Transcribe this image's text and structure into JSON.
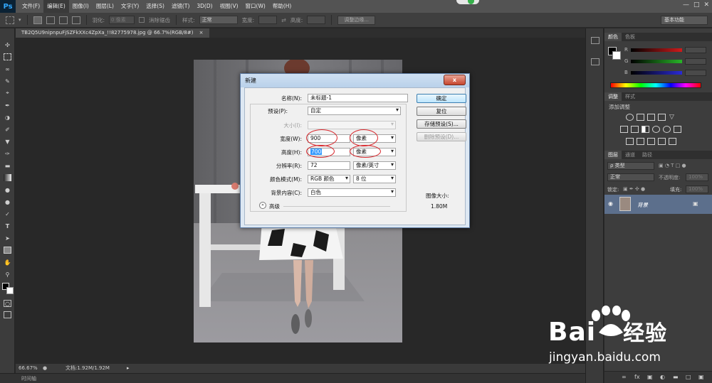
{
  "menubar": {
    "logo": "Ps",
    "items": [
      "文件(F)",
      "编辑(E)",
      "图像(I)",
      "图层(L)",
      "文字(Y)",
      "选择(S)",
      "滤镜(T)",
      "3D(D)",
      "视图(V)",
      "窗口(W)",
      "帮助(H)"
    ],
    "active_index": 1
  },
  "options_bar": {
    "feather_label": "羽化:",
    "feather_value": "0 像素",
    "antialias_label": "消除锯齿",
    "style_label": "样式:",
    "style_value": "正常",
    "width_label": "宽度:",
    "height_label": "高度:",
    "refine_edge_label": "调整边缘...",
    "workspace": "基本功能"
  },
  "document": {
    "tab_title": "TB2Q5U9nipnpuFjSZFkXXc4ZpXa_!!82775978.jpg @ 66.7%(RGB/8#)",
    "tab_close": "×",
    "zoom": "66.67%",
    "doc_info": "文档:1.92M/1.92M",
    "timeline_label": "时间轴"
  },
  "color_panel": {
    "tabs": [
      "颜色",
      "色板"
    ],
    "channels": [
      "R",
      "G",
      "B"
    ],
    "channel_colors": [
      "#d01b1b",
      "#28b428",
      "#2a2ad6"
    ]
  },
  "adjustments_panel": {
    "tabs": [
      "调整",
      "样式"
    ],
    "heading": "添加调整"
  },
  "layers_panel": {
    "tabs": [
      "图层",
      "通道",
      "路径"
    ],
    "filter_label": "ρ 类型",
    "blend_mode": "正常",
    "opacity_label": "不透明度:",
    "opacity_value": "100%",
    "lock_label": "锁定:",
    "fill_label": "填充:",
    "fill_value": "100%",
    "layer_name": "背景"
  },
  "new_dialog": {
    "title": "新建",
    "close": "x",
    "name_label": "名称(N):",
    "name_value": "未标题-1",
    "preset_label": "预设(P):",
    "preset_value": "自定",
    "size_label": "大小(I):",
    "width_label": "宽度(W):",
    "width_value": "900",
    "width_unit": "像素",
    "height_label": "高度(H):",
    "height_value": "700",
    "height_unit": "像素",
    "resolution_label": "分辨率(R):",
    "resolution_value": "72",
    "resolution_unit": "像素/英寸",
    "color_mode_label": "颜色模式(M):",
    "color_mode_value": "RGB 颜色",
    "bit_depth": "8 位",
    "background_label": "背景内容(C):",
    "background_value": "白色",
    "advanced_label": "高级",
    "advanced_icon": "chevron-double-down-icon",
    "buttons": {
      "ok": "确定",
      "reset": "复位",
      "save_preset": "存储预设(S)...",
      "delete_preset": "删除预设(D)..."
    },
    "image_size_label": "图像大小:",
    "image_size_value": "1.80M"
  },
  "watermark": {
    "brand_latin": "Bai",
    "brand_cn": "经验",
    "url": "jingyan.baidu.com"
  }
}
